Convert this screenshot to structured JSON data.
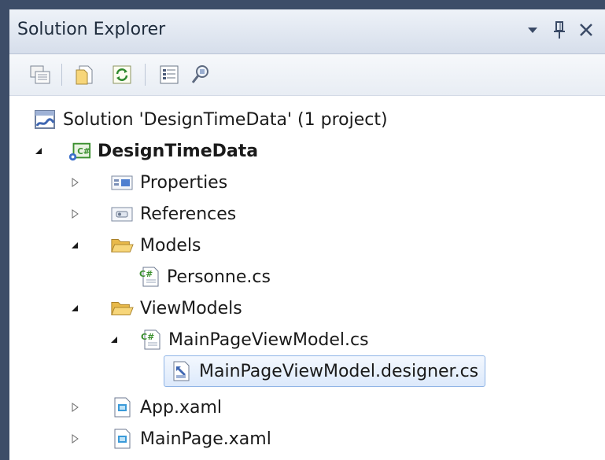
{
  "panel": {
    "title": "Solution Explorer",
    "controls": [
      "dropdown-icon",
      "pin-icon",
      "close-icon"
    ]
  },
  "toolbar": {
    "buttons": [
      "properties-icon",
      "show-all-files-icon",
      "refresh-icon",
      "view-code-icon",
      "class-view-icon"
    ]
  },
  "tree": {
    "solution": "Solution 'DesignTimeData' (1 project)",
    "project": "DesignTimeData",
    "properties": "Properties",
    "references": "References",
    "models": "Models",
    "personne": "Personne.cs",
    "viewmodels": "ViewModels",
    "mainpagevm": "MainPageViewModel.cs",
    "mainpagevm_designer": "MainPageViewModel.designer.cs",
    "app": "App.xaml",
    "mainpage": "MainPage.xaml"
  },
  "colors": {
    "frame": "#3d4d68",
    "selection_border": "#8fb4e6",
    "folder": "#f2c55c",
    "csharp_green": "#3a8f2e"
  }
}
